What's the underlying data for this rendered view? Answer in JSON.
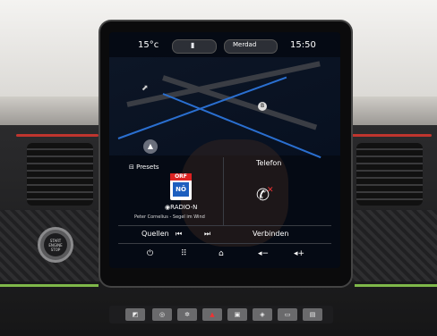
{
  "status": {
    "temperature": "15°c",
    "time": "15:50",
    "profile": "Merdad"
  },
  "widgets": {
    "presets_label": "Presets",
    "phone_label": "Telefon",
    "station_name": "RADIO-N",
    "track": "Peter Cornelius - Segel im Wind",
    "orf_logo_top": "ORF",
    "orf_logo_bottom": "NÖ"
  },
  "controls": {
    "sources": "Quellen",
    "prev": "⏮",
    "next": "⏭",
    "connect": "Verbinden"
  },
  "start_button": {
    "line1": "START",
    "line2": "ENGINE",
    "line3": "STOP"
  },
  "icons": {
    "power": "power-icon",
    "apps": "apps-grid-icon",
    "home": "home-icon",
    "vol_down": "volume-down-icon",
    "vol_up": "volume-up-icon",
    "phone": "phone-icon",
    "radio": "radio-icon"
  },
  "colors": {
    "accent_green": "#7fb84a",
    "accent_red": "#c0352e",
    "map_route": "#2a6fd0"
  }
}
